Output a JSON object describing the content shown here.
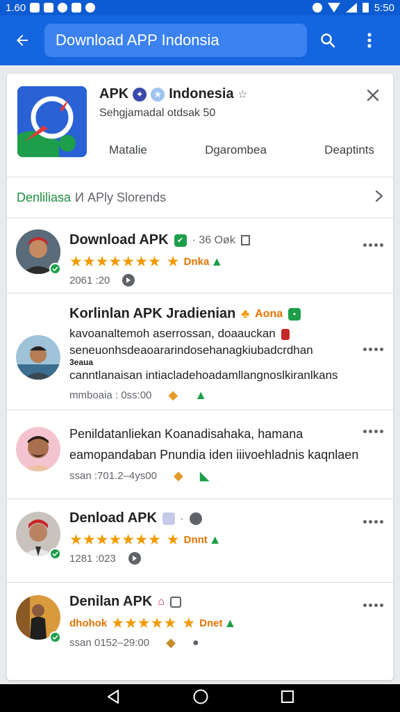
{
  "status_bar": {
    "time": "5:50",
    "left_text": "1.60"
  },
  "appbar": {
    "search_text": "Download APP Indonsia"
  },
  "app": {
    "title": "APK",
    "title_suffix": "Indonesia",
    "subtitle": "Sehgjamadal otdsak 50",
    "tabs": [
      "Matalie",
      "Dgarombea",
      "Deaptints"
    ]
  },
  "section": {
    "green_label": "Denliliasa",
    "gray_label": "И APly Slorends"
  },
  "reviews": [
    {
      "title": "Download APK",
      "extra": "· 36  Oøk",
      "rating_label": "Dnka",
      "meta": "2061 :20"
    },
    {
      "title": "Korlinlan APK Jradienian",
      "title_tag": "Aona",
      "lines": [
        "kavoanaltemoh aserrossan, doaauckan",
        "seneuonhsdeaoararindosehanagkiubadcrdhan",
        "3eaua",
        "canntlanaisan intiacladehoadamllangnoslkiranlkans"
      ],
      "meta": "mmboaia : 0ss:00"
    },
    {
      "title": "Penildatanliekan Koanadisahaka, hamana",
      "lines": [
        "eamopandaban Pnundia iden iiivoehladnis kaqnlaen"
      ],
      "meta": "ssan :701.2–4ys00"
    },
    {
      "title": "Denload APK",
      "rating_label": "Dnnt",
      "meta": "1281 :023"
    },
    {
      "title": "Denilan APK",
      "rating_label": "Dnet",
      "star_prefix": "dhohok",
      "meta": "ssan 0152–29:00"
    }
  ],
  "colors": {
    "primary": "#1565e0",
    "status_bar": "#0d5bd2",
    "star": "#f29900",
    "verified": "#1e9e4a"
  }
}
